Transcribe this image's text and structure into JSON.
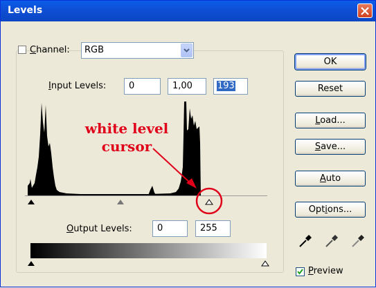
{
  "window": {
    "title": "Levels"
  },
  "channel": {
    "label_pre": "",
    "label_ul": "C",
    "label_post": "hannel:",
    "value": "RGB"
  },
  "input_levels": {
    "label_ul": "I",
    "label_post": "nput Levels:",
    "black": "0",
    "gamma": "1,00",
    "white": "193"
  },
  "output_levels": {
    "label_ul": "O",
    "label_post": "utput Levels:",
    "black": "0",
    "white": "255"
  },
  "buttons": {
    "ok": "OK",
    "reset": "Reset",
    "load_ul": "L",
    "load_post": "oad...",
    "save_ul": "S",
    "save_post": "ave...",
    "auto_ul": "A",
    "auto_post": "uto",
    "options_pre": "Opt",
    "options_ul": "i",
    "options_post": "ons..."
  },
  "preview": {
    "label_ul": "P",
    "label_post": "review",
    "checked": true
  },
  "annotation": {
    "line1": "white level",
    "line2": "cursor",
    "color": "#e0001a"
  },
  "colors": {
    "titlebar": "#0e4fd6",
    "dialog_bg": "#ece9d8",
    "selection": "#316ac5"
  }
}
